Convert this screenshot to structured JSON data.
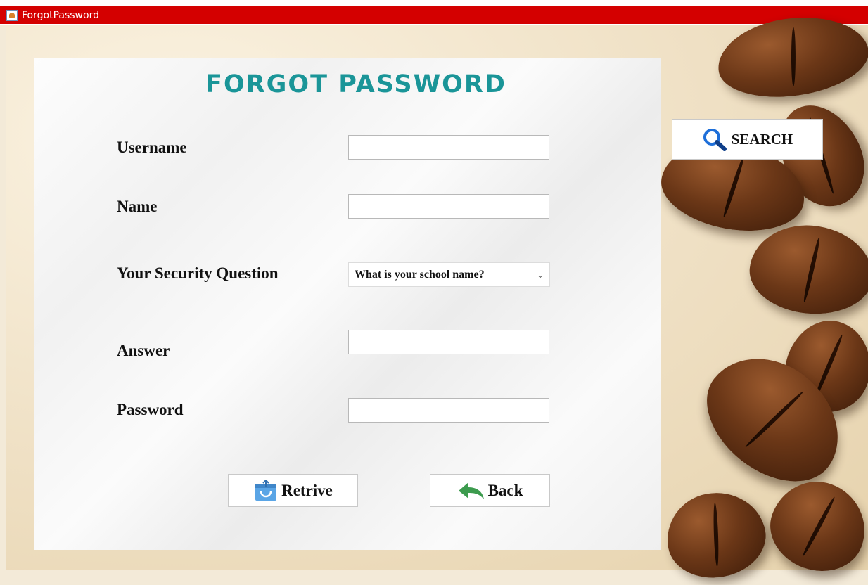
{
  "window": {
    "title": "ForgotPassword"
  },
  "form": {
    "heading": "FORGOT PASSWORD",
    "username_label": "Username",
    "name_label": "Name",
    "security_question_label": "Your Security Question",
    "security_question_value": "What is your school name?",
    "answer_label": "Answer",
    "password_label": "Password",
    "username_value": "",
    "name_value": "",
    "answer_value": "",
    "password_value": ""
  },
  "buttons": {
    "search": "SEARCH",
    "retrive": "Retrive",
    "back": "Back"
  },
  "icons": {
    "search": "magnifier-icon",
    "retrive": "retrieve-icon",
    "back": "back-arrow-icon"
  },
  "colors": {
    "titlebar": "#d40000",
    "heading": "#1a9598",
    "search_icon": "#1e6fd9",
    "back_icon": "#3c9b4e"
  }
}
